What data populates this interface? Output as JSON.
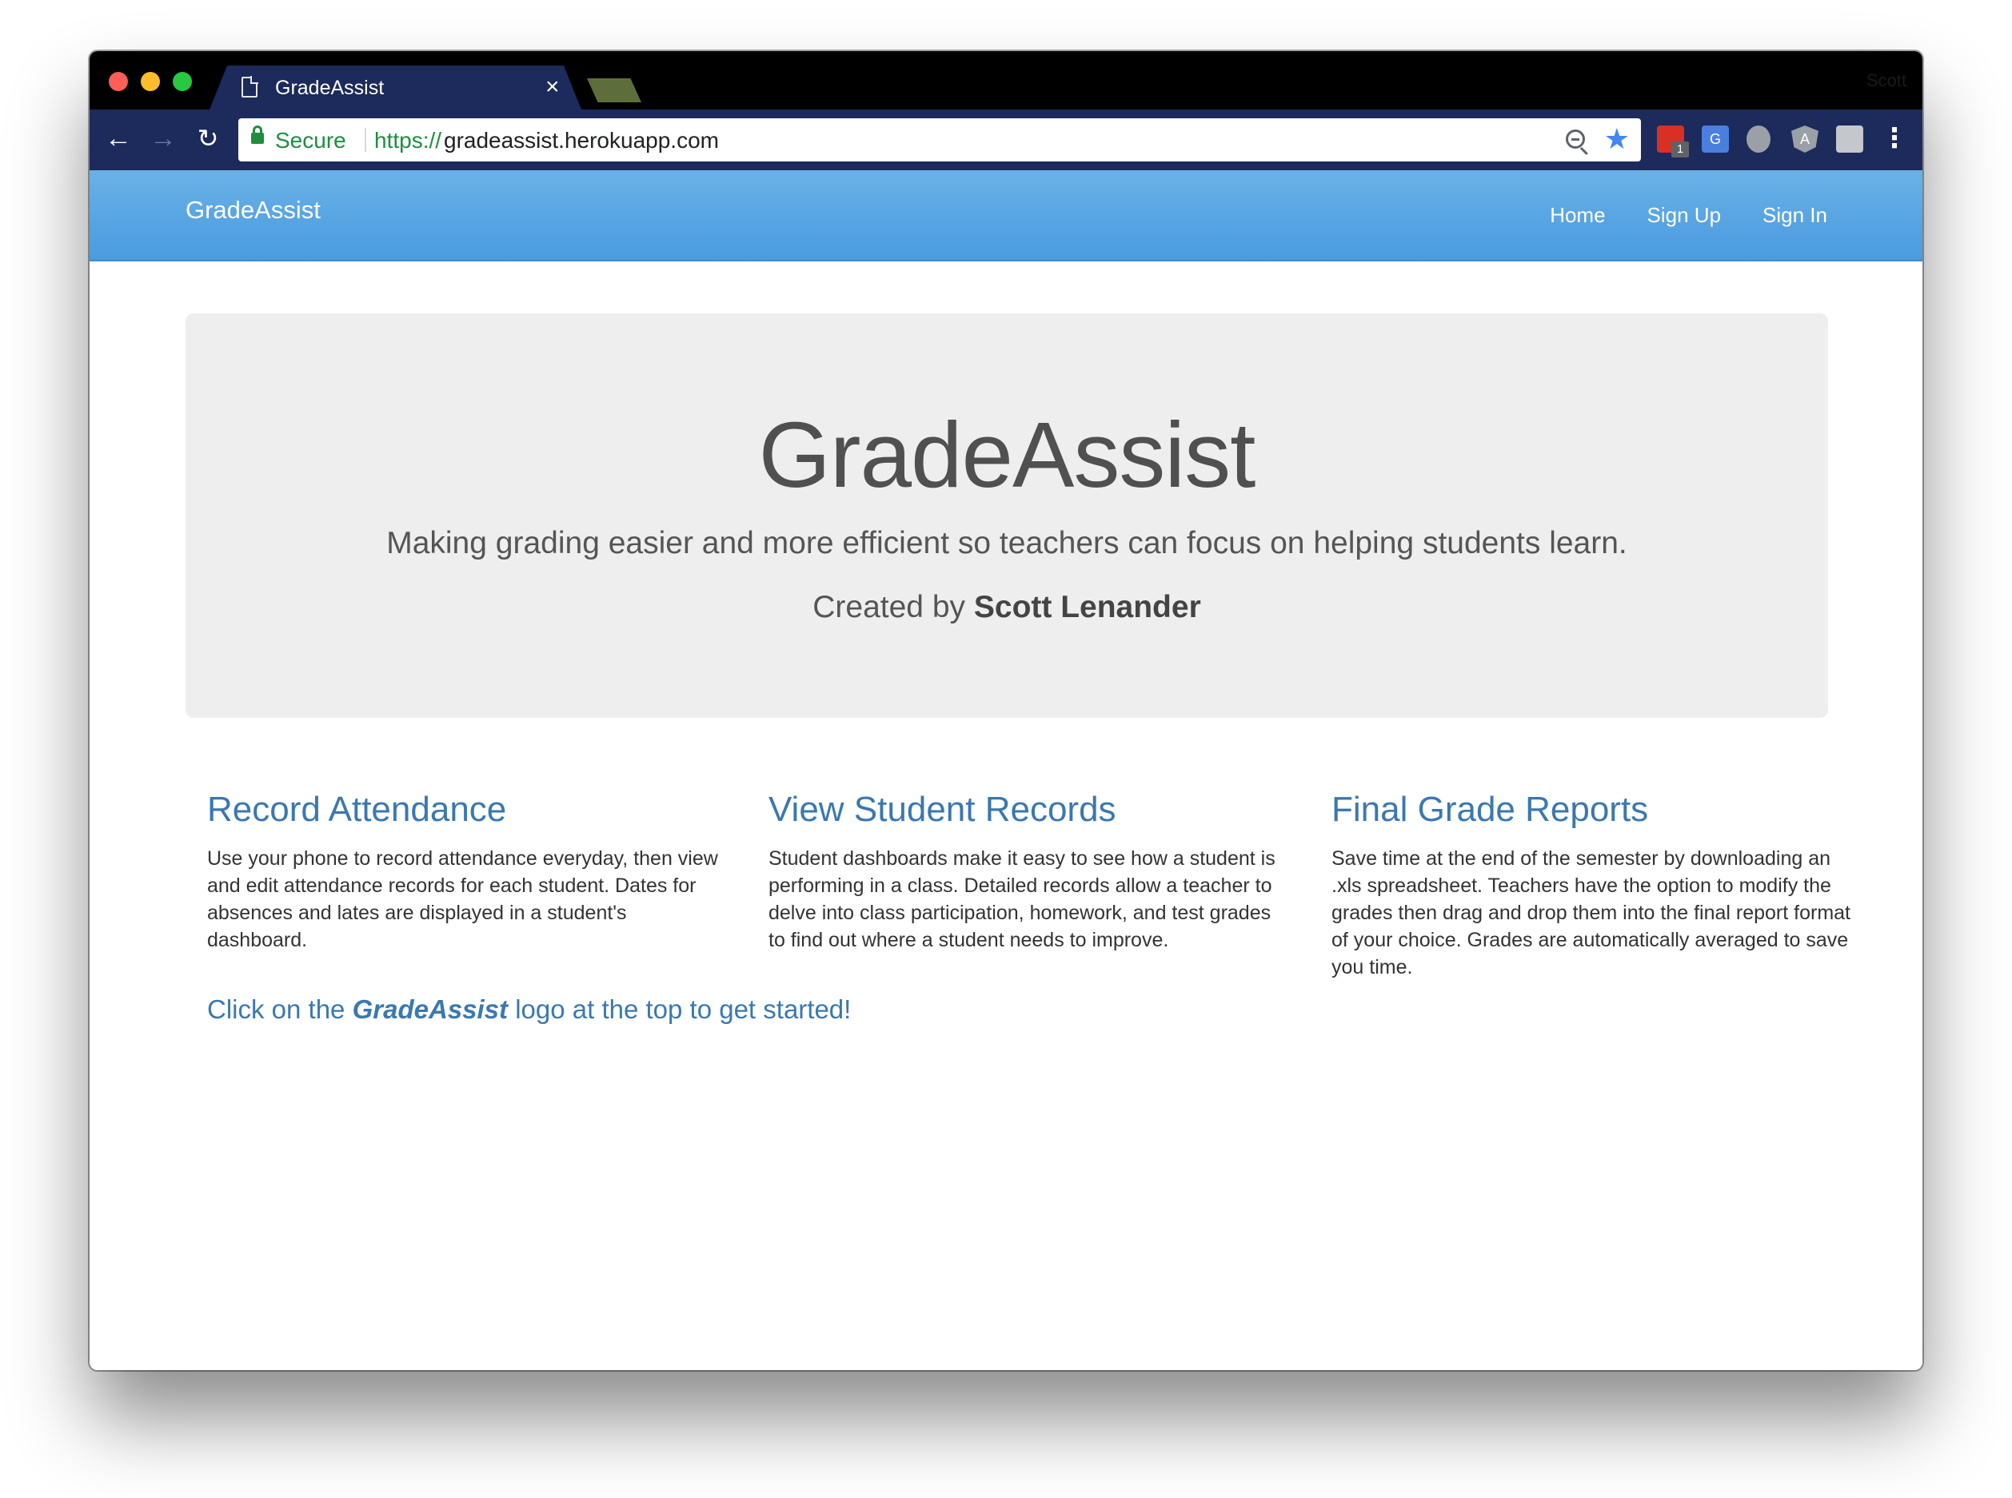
{
  "browser": {
    "tab_title": "GradeAssist",
    "profile_name": "Scott",
    "secure_label": "Secure",
    "url_scheme": "https://",
    "url_host": "gradeassist.herokuapp.com",
    "extension_badge": "1",
    "icons": [
      "back-arrow-icon",
      "forward-arrow-icon",
      "reload-icon",
      "lock-icon",
      "zoom-icon",
      "star-icon",
      "kebab-menu-icon"
    ]
  },
  "navbar": {
    "brand": "GradeAssist",
    "links": [
      "Home",
      "Sign Up",
      "Sign In"
    ]
  },
  "hero": {
    "title": "GradeAssist",
    "subtitle": "Making grading easier and more efficient so teachers can focus on helping students learn.",
    "credit_prefix": "Created by",
    "credit_name": "Scott Lenander"
  },
  "features": [
    {
      "title": "Record Attendance",
      "body": "Use your phone to record attendance everyday, then view and edit attendance records for each student. Dates for absences and lates are displayed in a student's dashboard."
    },
    {
      "title": "View Student Records",
      "body": "Student dashboards make it easy to see how a student is performing in a class. Detailed records allow a teacher to delve into class participation, homework, and test grades to find out where a student needs to improve."
    },
    {
      "title": "Final Grade Reports",
      "body": "Save time at the end of the semester by downloading an .xls spreadsheet. Teachers have the option to modify the grades then drag and drop them into the final report format of your choice. Grades are automatically averaged to save you time."
    }
  ],
  "cta": {
    "prefix": "Click on the",
    "emphasis": "GradeAssist",
    "suffix": "logo at the top to get started!"
  },
  "colors": {
    "navbar": "#4a9be0",
    "link": "#3a78b0",
    "jumbotron": "#eeeeee",
    "browser_chrome": "#1c2a5c"
  }
}
